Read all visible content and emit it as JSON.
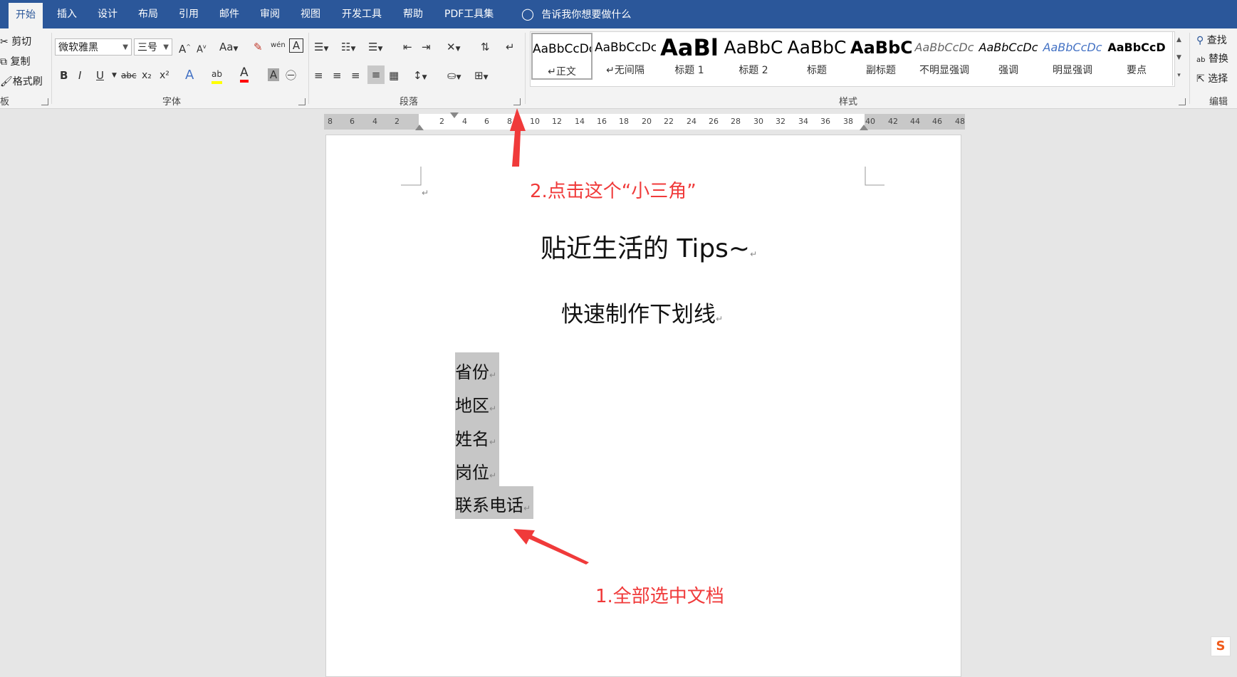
{
  "tabs": [
    "开始",
    "插入",
    "设计",
    "布局",
    "引用",
    "邮件",
    "审阅",
    "视图",
    "开发工具",
    "帮助",
    "PDF工具集"
  ],
  "tell_me": "告诉我你想要做什么",
  "clipboard": {
    "cut": "剪切",
    "copy": "复制",
    "format_painter": "格式刷",
    "label": "板"
  },
  "font": {
    "name": "微软雅黑",
    "size": "三号",
    "label": "字体",
    "case_btn": "Aa",
    "grow": "A",
    "shrink": "A",
    "phonetic": "wén",
    "bold": "B",
    "italic": "I",
    "underline": "U",
    "strike": "abc",
    "sub": "x₂",
    "sup": "x²",
    "highlight": "ab",
    "color": "A",
    "shade": "A"
  },
  "paragraph": {
    "label": "段落"
  },
  "styles": {
    "label": "样式",
    "items": [
      {
        "preview": "AaBbCcDc",
        "name": "正文"
      },
      {
        "preview": "AaBbCcDc",
        "name": "无间隔"
      },
      {
        "preview": "AaBl",
        "name": "标题 1"
      },
      {
        "preview": "AaBbC",
        "name": "标题 2"
      },
      {
        "preview": "AaBbC",
        "name": "标题"
      },
      {
        "preview": "AaBbC",
        "name": "副标题"
      },
      {
        "preview": "AaBbCcDc",
        "name": "不明显强调"
      },
      {
        "preview": "AaBbCcDc",
        "name": "强调"
      },
      {
        "preview": "AaBbCcDc",
        "name": "明显强调"
      },
      {
        "preview": "AaBbCcD",
        "name": "要点"
      }
    ]
  },
  "editing": {
    "find": "查找",
    "replace": "替换",
    "select": "选择",
    "label": "编辑"
  },
  "ruler": [
    "8",
    "6",
    "4",
    "2",
    "2",
    "4",
    "6",
    "8",
    "10",
    "12",
    "14",
    "16",
    "18",
    "20",
    "22",
    "24",
    "26",
    "28",
    "30",
    "32",
    "34",
    "36",
    "38",
    "40",
    "42",
    "44",
    "46",
    "48"
  ],
  "document": {
    "title": "贴近生活的 Tips~",
    "subtitle": "快速制作下划线",
    "lines": [
      "省份",
      "地区",
      "姓名",
      "岗位",
      "联系电话"
    ]
  },
  "annotations": {
    "step2": "2.点击这个“小三角”",
    "step1": "1.全部选中文档"
  },
  "colors": {
    "accent": "#2b579a",
    "annotation": "#f03a3a",
    "selection": "#c6c6c6"
  }
}
